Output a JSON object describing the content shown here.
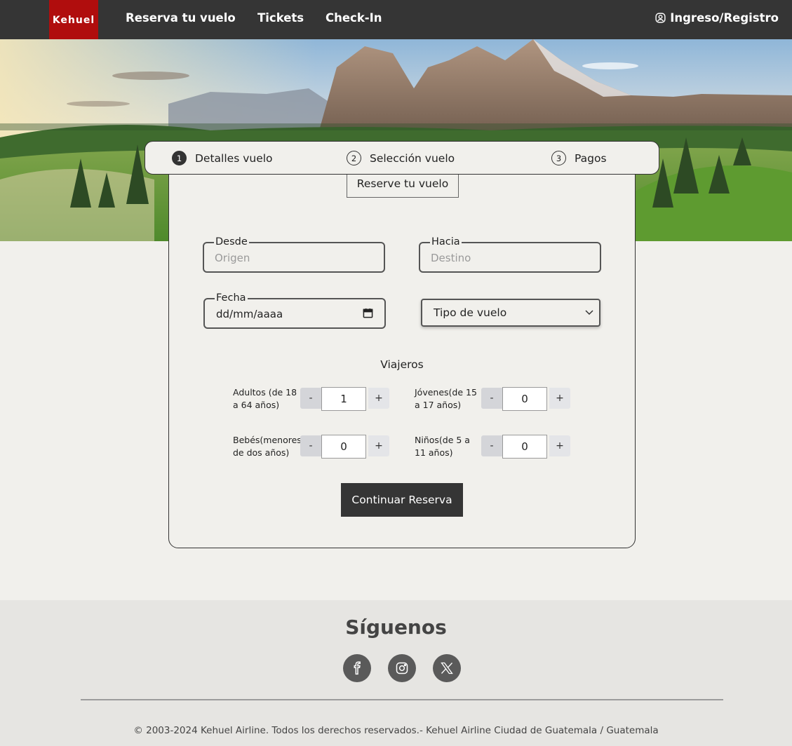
{
  "nav": {
    "logo": "Kehuel",
    "links": [
      "Reserva tu vuelo",
      "Tickets",
      "Check-In"
    ],
    "login": "Ingreso/Registro",
    "login_icon": "user-circle-icon"
  },
  "stepper": {
    "steps": [
      {
        "num": "1",
        "label": "Detalles vuelo",
        "active": true
      },
      {
        "num": "2",
        "label": "Selección vuelo",
        "active": false
      },
      {
        "num": "3",
        "label": "Pagos",
        "active": false
      }
    ]
  },
  "form": {
    "title": "Reserve tu vuelo",
    "from": {
      "label": "Desde",
      "placeholder": "Origen"
    },
    "to": {
      "label": "Hacia",
      "placeholder": "Destino"
    },
    "date": {
      "label": "Fecha",
      "value": "dd/mm/aaaa",
      "icon": "calendar-icon"
    },
    "flight_type": {
      "selected": "Tipo de vuelo",
      "icon": "chevron-down-icon"
    },
    "travelers_title": "Viajeros",
    "travelers": [
      {
        "label_line1": "Adultos (de 18",
        "label_line2": "a 64 años)",
        "value": "1"
      },
      {
        "label_line1": "Jóvenes(de 15",
        "label_line2": "a 17 años)",
        "value": "0"
      },
      {
        "label_line1": "Bebés(menores",
        "label_line2": "de dos años)",
        "value": "0"
      },
      {
        "label_line1": "Niños(de 5 a",
        "label_line2": "11 años)",
        "value": "0"
      }
    ],
    "minus": "-",
    "plus": "+",
    "continue": "Continuar Reserva"
  },
  "footer": {
    "title": "Síguenos",
    "social": [
      "facebook-icon",
      "instagram-icon",
      "x-icon"
    ],
    "copyright": "© 2003-2024 Kehuel Airline. Todos los derechos reservados.- Kehuel Airline Ciudad de Guatemala / Guatemala"
  },
  "colors": {
    "nav_bg": "#353535",
    "logo_bg": "#b00d0d",
    "page_bg": "#f1f0ec",
    "footer_bg": "#e6e5e2",
    "button_bg": "#353535"
  }
}
